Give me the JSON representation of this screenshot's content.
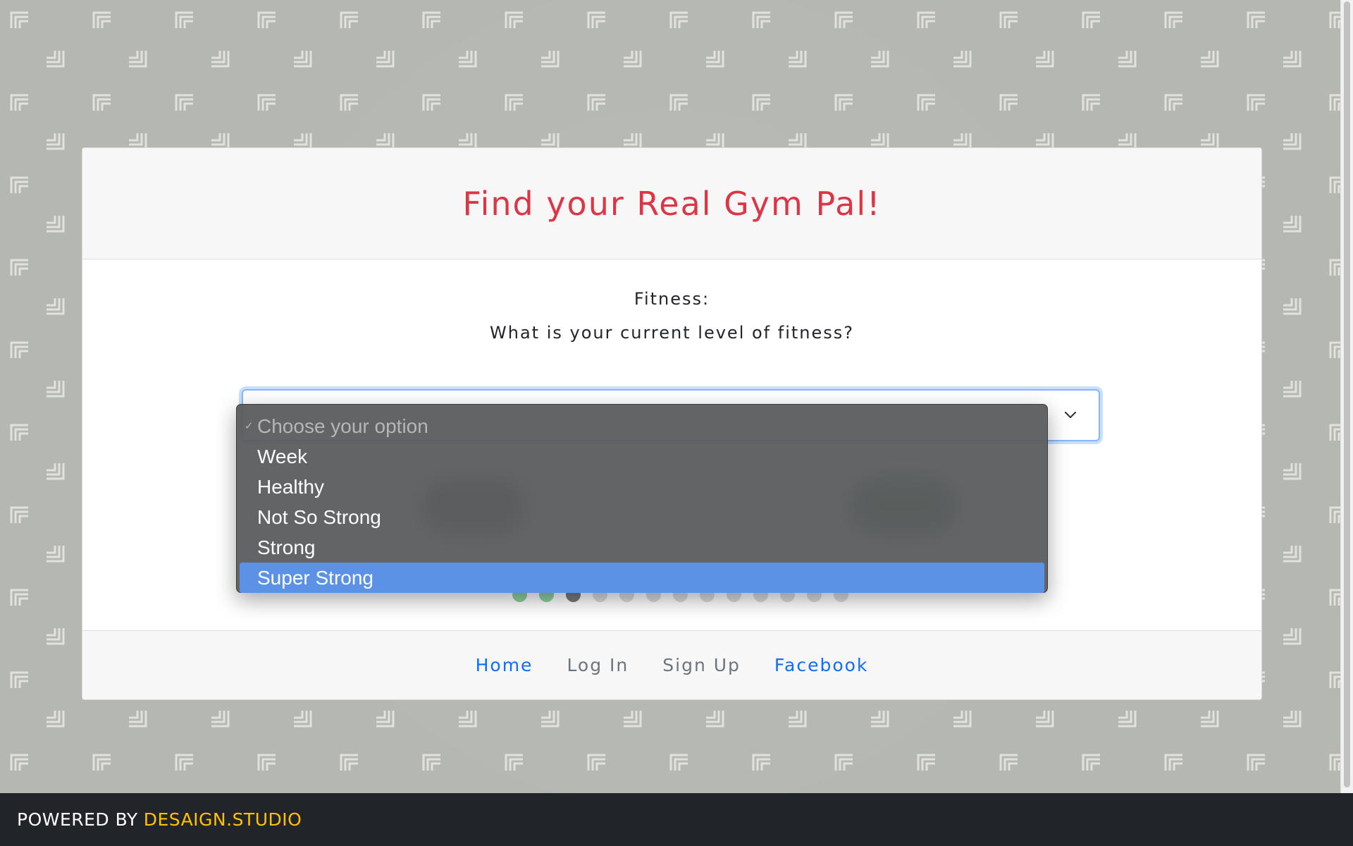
{
  "page": {
    "title": "Find your Real Gym Pal!"
  },
  "form": {
    "section_label": "Fitness:",
    "question": "What is your current level of fitness?",
    "select": {
      "options": [
        "Choose your option",
        "Week",
        "Healthy",
        "Not So Strong",
        "Strong",
        "Super Strong"
      ],
      "checked_option": "Choose your option",
      "highlighted_option": "Super Strong",
      "check_glyph": "✓"
    },
    "progress": {
      "total_steps": 13,
      "completed_steps": 2,
      "current_step": 3
    }
  },
  "footer_nav": {
    "home": "Home",
    "login": "Log In",
    "signup": "Sign Up",
    "facebook": "Facebook"
  },
  "bottom_bar": {
    "powered_by": "POWERED BY",
    "brand": "DESAIGN.STUDIO"
  },
  "colors": {
    "title": "#dc3545",
    "link_active": "#0d6efd",
    "link_muted": "#6c757d",
    "brand": "#ffc107",
    "progress_done": "#8fd19e",
    "progress_current": "#7a7a7a",
    "highlight": "#5b92e6"
  },
  "icons": {
    "select_arrow": "chevron-down-icon",
    "checkmark": "checkmark-icon"
  }
}
